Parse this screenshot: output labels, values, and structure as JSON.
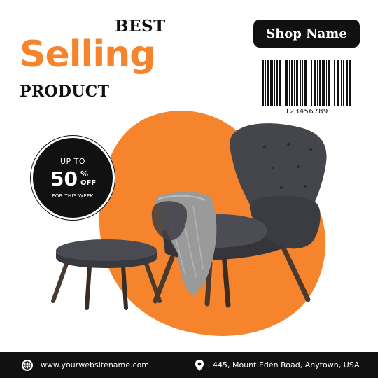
{
  "headline": {
    "line1": "BEST",
    "line2": "Selling",
    "line3": "PRODUCT"
  },
  "shop": {
    "name": "Shop Name"
  },
  "barcode": {
    "number": "123456789"
  },
  "discount": {
    "prefix": "UP TO",
    "value": "50",
    "percent_sign": "%",
    "suffix": "OFF",
    "period": "FOR THIS WEEK"
  },
  "footer": {
    "website": "www.yourwebsitename.com",
    "address": "445, Mount Eden Road, Anytown, USA",
    "website_icon": "globe-icon",
    "address_icon": "location-pin-icon"
  },
  "colors": {
    "accent": "#f5842c",
    "dark": "#111111",
    "background": "#ffffff",
    "upholstery": "#3f3f45",
    "wood": "#4a3a2e",
    "throw": "#9a9a9a"
  }
}
